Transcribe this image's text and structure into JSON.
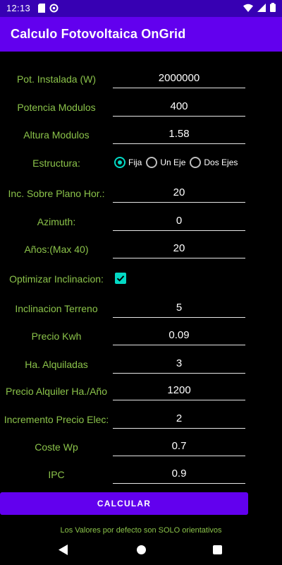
{
  "status_bar": {
    "time": "12:13"
  },
  "app_bar": {
    "title": "Calculo Fotovoltaica OnGrid"
  },
  "form": {
    "pot_instalada": {
      "label": "Pot. Instalada (W)",
      "value": "2000000"
    },
    "potencia_modulos": {
      "label": "Potencia Modulos",
      "value": "400"
    },
    "altura_modulos": {
      "label": "Altura Modulos",
      "value": "1.58"
    },
    "estructura": {
      "label": "Estructura:",
      "options": [
        "Fija",
        "Un Eje",
        "Dos Ejes"
      ],
      "selected": "Fija"
    },
    "inc_plano": {
      "label": "Inc. Sobre Plano Hor.:",
      "value": "20"
    },
    "azimuth": {
      "label": "Azimuth:",
      "value": "0"
    },
    "anos": {
      "label": "Años:(Max 40)",
      "value": "20"
    },
    "optimizar": {
      "label": "Optimizar Inclinacion:",
      "checked": true
    },
    "inclinacion_terreno": {
      "label": "Inclinacion Terreno",
      "value": "5"
    },
    "precio_kwh": {
      "label": "Precio Kwh",
      "value": "0.09"
    },
    "ha_alquiladas": {
      "label": "Ha. Alquiladas",
      "value": "3"
    },
    "precio_alquiler": {
      "label": "Precio Alquiler Ha./Año",
      "value": "1200"
    },
    "incremento_precio": {
      "label": "Incremento Precio Elec:",
      "value": "2"
    },
    "coste_wp": {
      "label": "Coste Wp",
      "value": "0.7"
    },
    "ipc": {
      "label": "IPC",
      "value": "0.9"
    }
  },
  "calc_button": {
    "label": "CALCULAR"
  },
  "footnote": "Los Valores por defecto son SOLO orientativos",
  "colors": {
    "app_bar": "#6200ee",
    "status_bar": "#3700b3",
    "label_green": "#8bc34a",
    "accent_teal": "#03dac5",
    "background": "#000000"
  },
  "icons": {
    "status_left": [
      "sd-card-icon",
      "sync-icon"
    ],
    "status_right": [
      "wifi-icon",
      "signal-icon",
      "battery-icon"
    ],
    "nav": [
      "back-icon",
      "home-icon",
      "recents-icon"
    ]
  }
}
